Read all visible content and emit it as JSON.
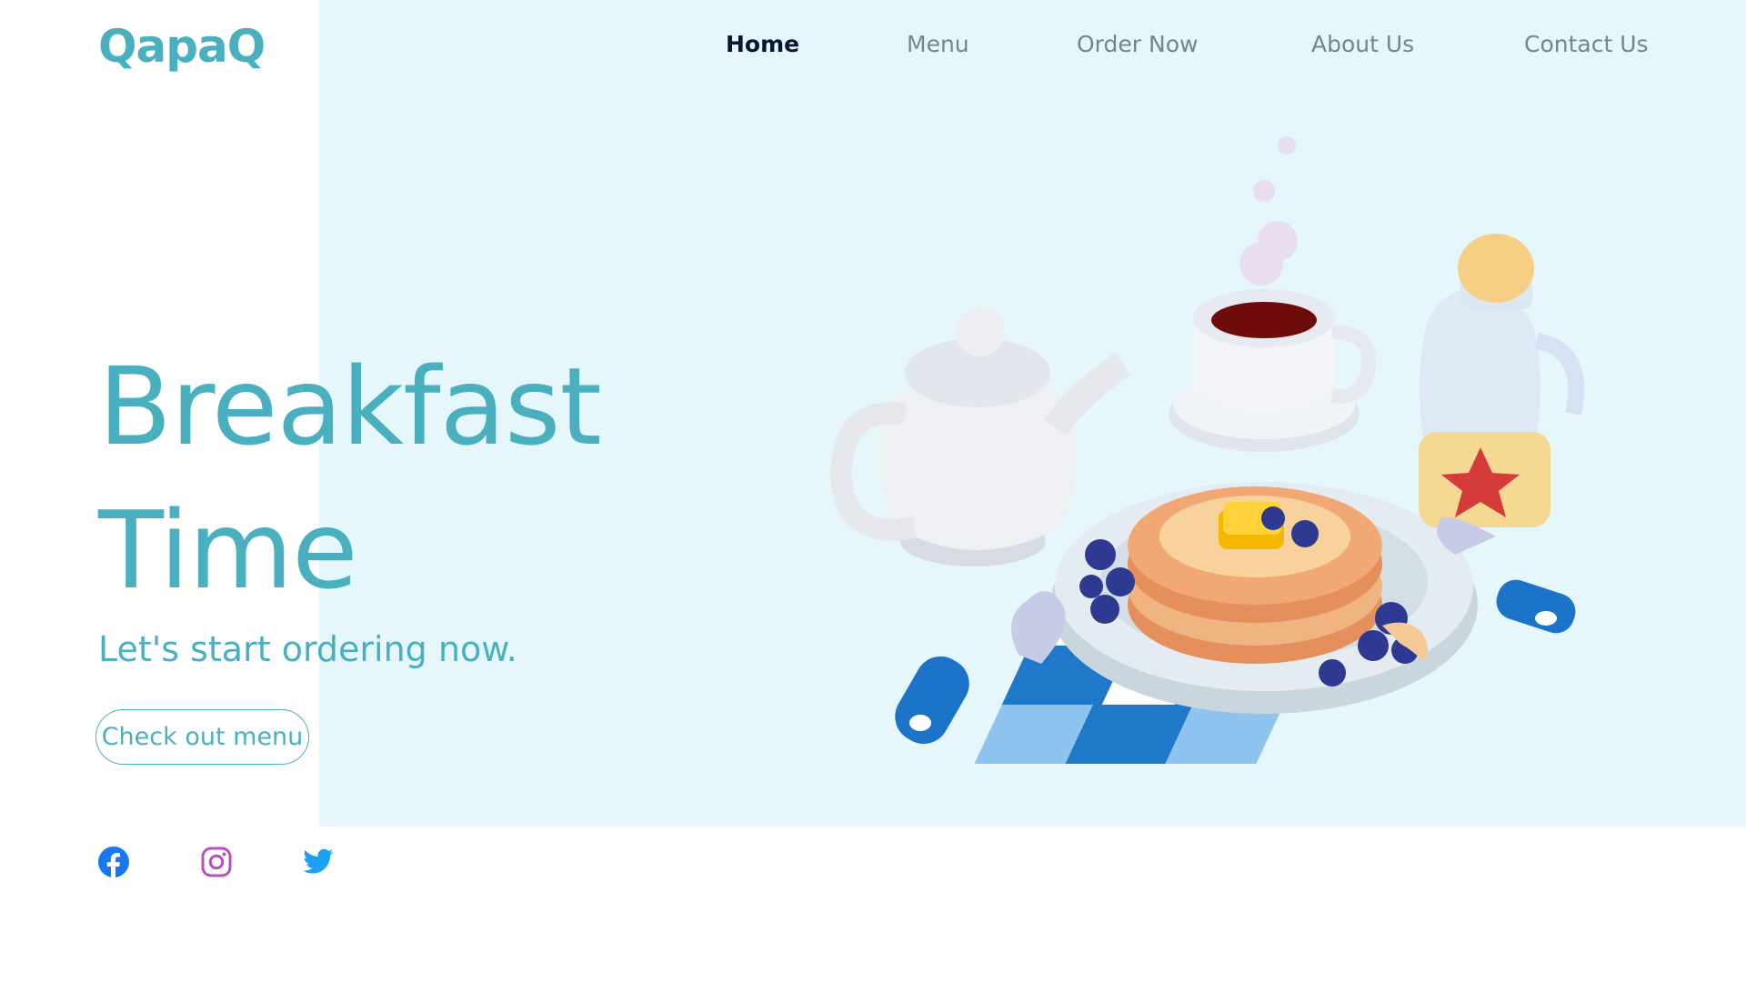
{
  "brand": {
    "logo": "QapaQ"
  },
  "nav": {
    "items": [
      {
        "label": "Home",
        "active": true
      },
      {
        "label": "Menu",
        "active": false
      },
      {
        "label": "Order Now",
        "active": false
      },
      {
        "label": "About Us",
        "active": false
      },
      {
        "label": "Contact Us",
        "active": false
      }
    ]
  },
  "hero": {
    "title_line1": "Breakfast",
    "title_line2": "Time",
    "subtitle": "Let's start ordering now.",
    "cta_label": "Check out menu"
  },
  "social": [
    {
      "icon": "facebook-icon",
      "color": "#1877f2"
    },
    {
      "icon": "instagram-icon",
      "color": "#b84fbf"
    },
    {
      "icon": "twitter-icon",
      "color": "#1da1f2"
    }
  ],
  "colors": {
    "accent": "#4ab0bf",
    "hero_background": "#e6f7fc",
    "nav_active": "#0b1530",
    "nav_inactive": "#6f8a83"
  },
  "illustration": {
    "icon": "breakfast-illustration"
  }
}
